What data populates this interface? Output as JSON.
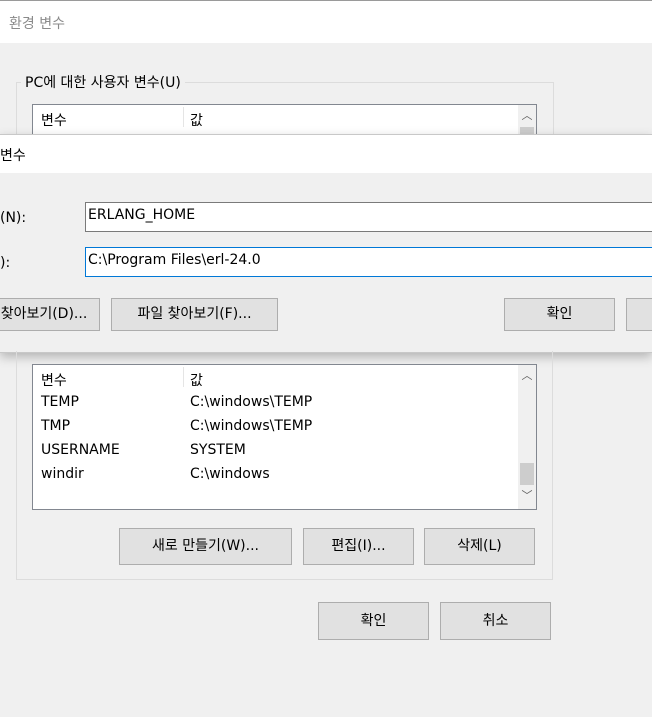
{
  "window": {
    "title": "환경 변수"
  },
  "user_group": {
    "label": "PC에 대한 사용자 변수(U)",
    "columns": [
      "변수",
      "값"
    ]
  },
  "system_group": {
    "columns": [
      "변수",
      "값"
    ],
    "rows": [
      {
        "name": "TEMP",
        "value": "C:\\windows\\TEMP"
      },
      {
        "name": "TMP",
        "value": "C:\\windows\\TEMP"
      },
      {
        "name": "USERNAME",
        "value": "SYSTEM"
      },
      {
        "name": "windir",
        "value": "C:\\windows"
      }
    ],
    "buttons": {
      "new": "새로 만들기(W)...",
      "edit": "편집(I)...",
      "delete": "삭제(L)"
    }
  },
  "footer": {
    "ok": "확인",
    "cancel": "취소"
  },
  "dialog": {
    "title": "변수",
    "name_label": "(N):",
    "name_value": "ERLANG_HOME",
    "value_label": "):",
    "value_value": "C:\\Program Files\\erl-24.0",
    "browse_dir": "찾아보기(D)...",
    "browse_file": "파일 찾아보기(F)...",
    "ok": "확인"
  },
  "colors": {
    "focus_border": "#0078d7",
    "button_bg": "#e1e1e1"
  }
}
